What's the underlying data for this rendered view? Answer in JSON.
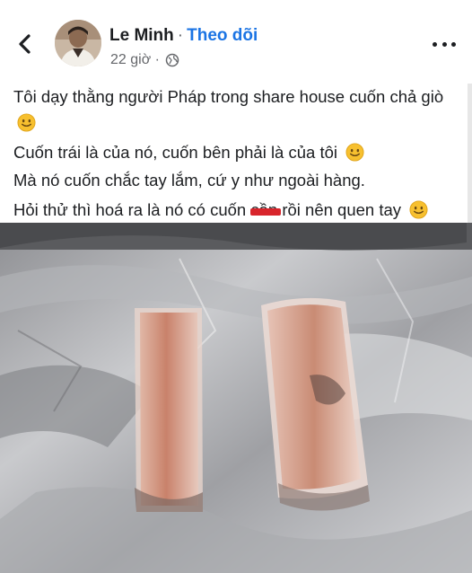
{
  "header": {
    "author_name": "Le Minh",
    "separator": "·",
    "follow_label": "Theo dõi",
    "timestamp": "22 giờ ·",
    "icons": {
      "back": "chevron-left-icon",
      "privacy": "globe-icon",
      "more": "more-horizontal-icon"
    }
  },
  "post": {
    "line1": "Tôi dạy thằng người Pháp trong share house cuốn chả giò",
    "line2": "Cuốn trái là của nó, cuốn bên phải là của tôi",
    "line3": "Mà nó cuốn chắc tay lắm, cứ y như ngoài hàng.",
    "line4_before": "Hỏi thử thì hoá ra là nó có cuốn",
    "line4_censored": "cần",
    "line4_after": "rồi nên quen tay"
  },
  "colors": {
    "link": "#1b74e4",
    "meta": "#65676b",
    "censor_bar": "#d8252c",
    "emoji": "#f7c02f"
  }
}
